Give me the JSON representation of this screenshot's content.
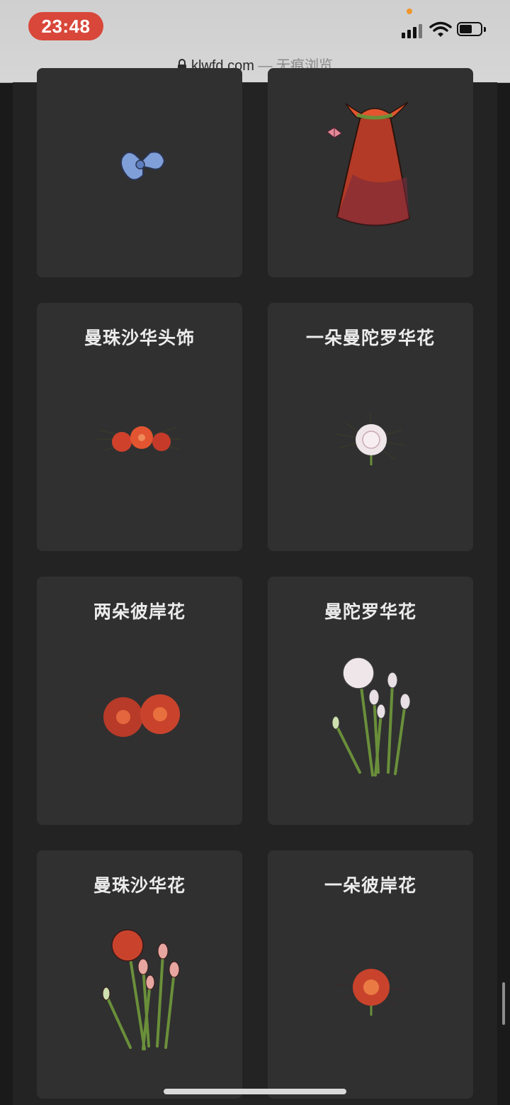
{
  "status_bar": {
    "time": "23:48",
    "icons": [
      "signal-icon",
      "wifi-icon",
      "battery-icon"
    ]
  },
  "browser": {
    "domain": "klwfd.com",
    "mode": " — 无痕浏览"
  },
  "cards": [
    {
      "title": "",
      "icon": "blue-bow-icon"
    },
    {
      "title": "",
      "icon": "red-lily-dress-icon"
    },
    {
      "title": "曼珠沙华头饰",
      "icon": "red-flower-headpiece-icon"
    },
    {
      "title": "一朵曼陀罗华花",
      "icon": "white-spider-lily-icon"
    },
    {
      "title": "两朵彼岸花",
      "icon": "two-red-spider-lilies-icon"
    },
    {
      "title": "曼陀罗华花",
      "icon": "white-lily-plant-icon"
    },
    {
      "title": "曼珠沙华花",
      "icon": "red-lily-plant-icon"
    },
    {
      "title": "一朵彼岸花",
      "icon": "red-spider-lily-icon"
    }
  ],
  "colors": {
    "time_pill": "#d8473a",
    "card_bg": "#303030",
    "page_bg": "#1a1a1a",
    "red_flower": "#d0412c",
    "white_flower": "#efe6ea",
    "stem": "#6a8f3a"
  }
}
